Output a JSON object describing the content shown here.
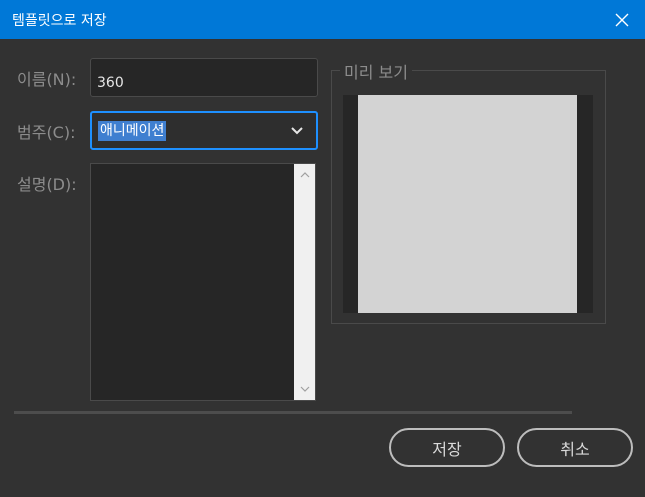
{
  "window": {
    "title": "템플릿으로 저장",
    "close_icon": "close-icon"
  },
  "form": {
    "name_label": "이름(N):",
    "name_value": "360",
    "category_label": "범주(C):",
    "category_value": "애니메이션",
    "description_label": "설명(D):",
    "description_value": ""
  },
  "preview": {
    "legend": "미리 보기"
  },
  "buttons": {
    "save": "저장",
    "cancel": "취소"
  },
  "colors": {
    "titlebar": "#0078d7",
    "background": "#323232",
    "focus_border": "#1e90ff",
    "selection": "#3f7fd0"
  }
}
